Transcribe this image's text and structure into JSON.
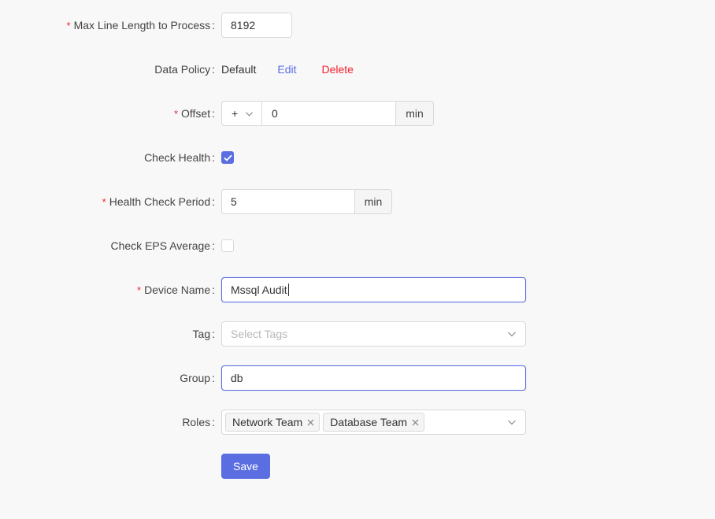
{
  "form": {
    "max_line": {
      "label": "Max Line Length to Process",
      "required": true,
      "value": "8192"
    },
    "data_policy": {
      "label": "Data Policy",
      "value": "Default",
      "edit_label": "Edit",
      "delete_label": "Delete"
    },
    "offset": {
      "label": "Offset",
      "required": true,
      "sign": "+",
      "value": "0",
      "unit": "min"
    },
    "check_health": {
      "label": "Check Health",
      "checked": true
    },
    "health_period": {
      "label": "Health Check Period",
      "required": true,
      "value": "5",
      "unit": "min"
    },
    "check_eps": {
      "label": "Check EPS Average",
      "checked": false
    },
    "device_name": {
      "label": "Device Name",
      "required": true,
      "value": "Mssql Audit"
    },
    "tag": {
      "label": "Tag",
      "placeholder": "Select Tags"
    },
    "group": {
      "label": "Group",
      "value": "db"
    },
    "roles": {
      "label": "Roles",
      "selected": [
        "Network Team",
        "Database Team"
      ]
    },
    "save_label": "Save"
  },
  "colors": {
    "accent": "#5b6ee1",
    "danger": "#f5222d",
    "border": "#d9d9d9",
    "background": "#f8f8f8"
  },
  "icons": {
    "check": "check-icon",
    "chevron": "chevron-down-icon",
    "close": "close-icon"
  }
}
